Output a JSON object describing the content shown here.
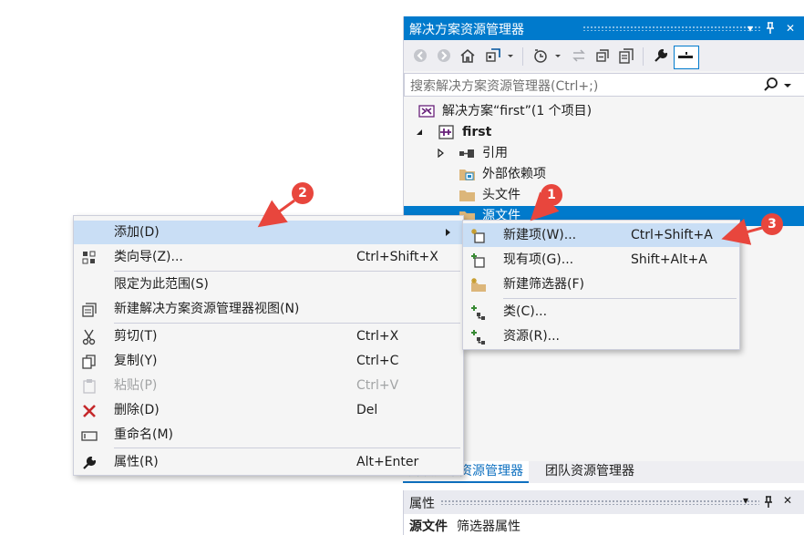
{
  "solution_explorer": {
    "title": "解决方案资源管理器",
    "title_buttons": [
      "▾",
      "⊥",
      "✕"
    ],
    "toolbar_icons": [
      "back-icon",
      "forward-icon",
      "home-icon",
      "switch-views-icon",
      "dropdown-icon",
      "pending-changes-icon",
      "dropdown-icon",
      "sync-icon",
      "collapse-all-icon",
      "show-all-files-icon",
      "properties-icon",
      "preview-icon"
    ],
    "search_placeholder": "搜索解决方案资源管理器(Ctrl+;)",
    "tree": {
      "solution": "解决方案“first”(1 个项目)",
      "project": "first",
      "references": "引用",
      "external_deps": "外部依赖项",
      "header_files": "头文件",
      "source_files": "源文件"
    },
    "tabs": [
      "解决方案资源管理器",
      "团队资源管理器"
    ]
  },
  "properties": {
    "title": "属性",
    "object_name": "源文件",
    "object_type": "筛选器属性"
  },
  "context_menu": {
    "items": [
      {
        "label": "添加(D)",
        "shortcut": "",
        "icon": ""
      },
      {
        "label": "类向导(Z)...",
        "shortcut": "Ctrl+Shift+X",
        "icon": "class-wizard-icon"
      },
      {
        "label": "限定为此范围(S)",
        "shortcut": "",
        "icon": ""
      },
      {
        "label": "新建解决方案资源管理器视图(N)",
        "shortcut": "",
        "icon": "new-view-icon"
      },
      {
        "label": "剪切(T)",
        "shortcut": "Ctrl+X",
        "icon": "scissors-icon"
      },
      {
        "label": "复制(Y)",
        "shortcut": "Ctrl+C",
        "icon": "copy-icon"
      },
      {
        "label": "粘贴(P)",
        "shortcut": "Ctrl+V",
        "icon": "paste-icon"
      },
      {
        "label": "删除(D)",
        "shortcut": "Del",
        "icon": "delete-icon"
      },
      {
        "label": "重命名(M)",
        "shortcut": "",
        "icon": "rename-icon"
      },
      {
        "label": "属性(R)",
        "shortcut": "Alt+Enter",
        "icon": "wrench-icon"
      }
    ]
  },
  "submenu": {
    "items": [
      {
        "label": "新建项(W)...",
        "shortcut": "Ctrl+Shift+A",
        "icon": "new-item-icon"
      },
      {
        "label": "现有项(G)...",
        "shortcut": "Shift+Alt+A",
        "icon": "existing-item-icon"
      },
      {
        "label": "新建筛选器(F)",
        "shortcut": "",
        "icon": "new-filter-icon"
      },
      {
        "label": "类(C)...",
        "shortcut": "",
        "icon": "class-icon"
      },
      {
        "label": "资源(R)...",
        "shortcut": "",
        "icon": "resource-icon"
      }
    ]
  },
  "annotations": {
    "badge1": "1",
    "badge2": "2",
    "badge3": "3",
    "color": "#e8463d"
  }
}
